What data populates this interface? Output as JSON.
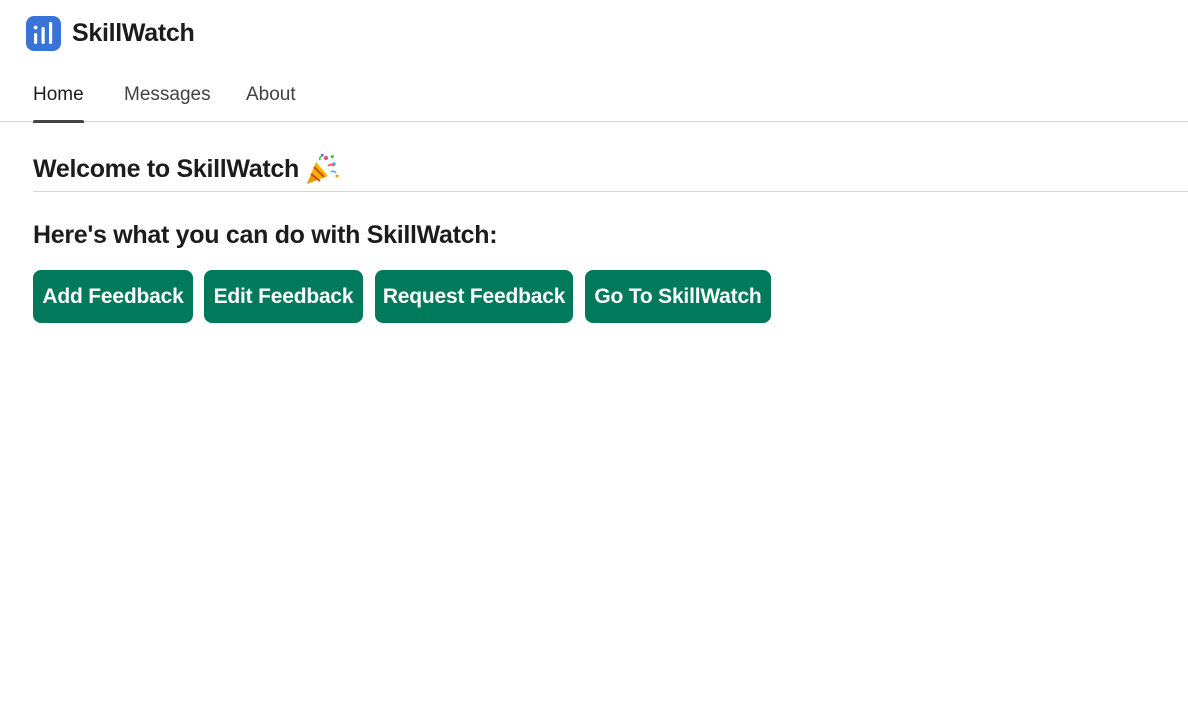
{
  "app": {
    "name": "SkillWatch",
    "icon": "bar-chart-icon",
    "icon_color": "#3a73d8"
  },
  "tabs": [
    {
      "label": "Home",
      "active": true
    },
    {
      "label": "Messages",
      "active": false
    },
    {
      "label": "About",
      "active": false
    }
  ],
  "main": {
    "welcome_title": "Welcome to SkillWatch",
    "welcome_icon": "party-popper-icon",
    "subheading": "Here's what you can do with SkillWatch:",
    "buttons": [
      {
        "label": "Add Feedback"
      },
      {
        "label": "Edit Feedback"
      },
      {
        "label": "Request Feedback"
      },
      {
        "label": "Go To SkillWatch"
      }
    ],
    "button_color": "#007a5a"
  }
}
